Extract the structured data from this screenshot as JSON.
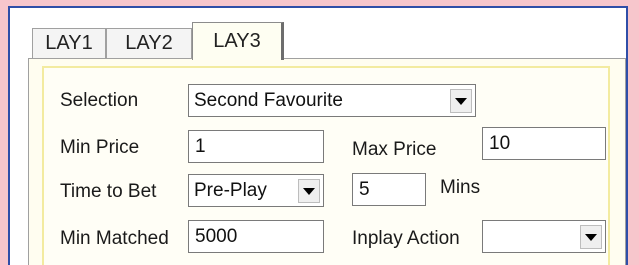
{
  "tabs": [
    {
      "label": "LAY1",
      "active": false
    },
    {
      "label": "LAY2",
      "active": false
    },
    {
      "label": "LAY3",
      "active": true
    }
  ],
  "form": {
    "selection_label": "Selection",
    "selection_value": "Second Favourite",
    "min_price_label": "Min Price",
    "min_price_value": "1",
    "max_price_label": "Max Price",
    "max_price_value": "10",
    "time_to_bet_label": "Time to Bet",
    "time_to_bet_value": "Pre-Play",
    "mins_value": "5",
    "mins_label": "Mins",
    "min_matched_label": "Min Matched",
    "min_matched_value": "5000",
    "inplay_action_label": "Inplay Action",
    "inplay_action_value": ""
  },
  "colors": {
    "outer_border": "#2f4ea8",
    "background_accent": "#f7c6cc",
    "group_border": "#f3eba0"
  },
  "icons": {
    "dropdown": "chevron-down-icon"
  }
}
